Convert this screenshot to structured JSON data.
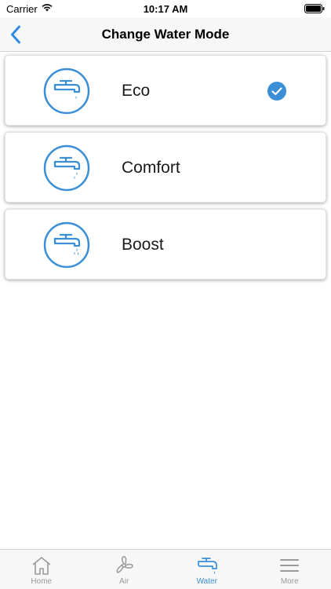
{
  "status_bar": {
    "carrier": "Carrier",
    "time": "10:17 AM"
  },
  "nav": {
    "title": "Change Water Mode",
    "back_icon": "chevron-left-icon"
  },
  "modes": [
    {
      "label": "Eco",
      "icon": "faucet-eco-icon",
      "selected": true
    },
    {
      "label": "Comfort",
      "icon": "faucet-comfort-icon",
      "selected": false
    },
    {
      "label": "Boost",
      "icon": "faucet-boost-icon",
      "selected": false
    }
  ],
  "tabs": [
    {
      "label": "Home",
      "icon": "home-icon",
      "active": false
    },
    {
      "label": "Air",
      "icon": "fan-icon",
      "active": false
    },
    {
      "label": "Water",
      "icon": "faucet-icon",
      "active": true
    },
    {
      "label": "More",
      "icon": "menu-icon",
      "active": false
    }
  ],
  "colors": {
    "accent": "#3a8fd6",
    "inactive": "#9a9a9a",
    "bar_background": "#f7f7f7"
  }
}
